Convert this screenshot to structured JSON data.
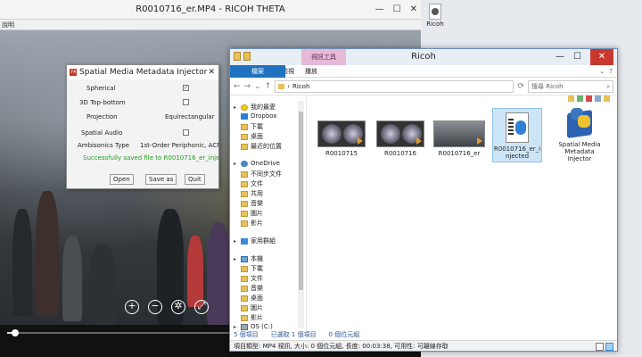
{
  "desktop": {
    "icon_label": "Ricoh"
  },
  "player": {
    "title": "R0010716_er.MP4 - RICOH THETA",
    "menu": "說明",
    "seek_progress": 0.02
  },
  "injector": {
    "title": "Spatial Media Metadata Injector",
    "app_mark": "74",
    "spherical_label": "Spherical",
    "spherical_checked": "✓",
    "top_bottom_label": "3D Top-bottom",
    "projection_label": "Projection",
    "projection_value": "Equirectangular",
    "spatial_audio_label": "Spatial Audio",
    "ambisonics_label": "Ambisonics Type",
    "ambisonics_value": "1st-Order Periphonic, ACN, SN3D",
    "status": "Successfully saved file to R0010716_er_injected.MP4",
    "open_label": "Open",
    "save_as_label": "Save as",
    "quit_label": "Quit",
    "status_color": "#1aa31a"
  },
  "explorer": {
    "title": "Ricoh",
    "context_tab": "視訊工具",
    "ribbon_tabs": [
      "檔案",
      "常用",
      "共用",
      "檢視",
      "播放"
    ],
    "path": "Ricoh",
    "search_placeholder": "搜尋 Ricoh",
    "nav": [
      {
        "label": "我的最愛"
      },
      {
        "label": "Dropbox"
      },
      {
        "label": "下載"
      },
      {
        "label": "桌面"
      },
      {
        "label": "最近的位置"
      },
      {
        "label": "OneDrive"
      },
      {
        "label": "不同步文件"
      },
      {
        "label": "文件"
      },
      {
        "label": "共用"
      },
      {
        "label": "音樂"
      },
      {
        "label": "圖片"
      },
      {
        "label": "影片"
      },
      {
        "label": "家用群組"
      },
      {
        "label": "本機"
      },
      {
        "label": "下載"
      },
      {
        "label": "文件"
      },
      {
        "label": "音樂"
      },
      {
        "label": "桌面"
      },
      {
        "label": "圖片"
      },
      {
        "label": "影片"
      },
      {
        "label": "OS (C:)"
      }
    ],
    "files": [
      {
        "name": "R0010715"
      },
      {
        "name": "R0010716"
      },
      {
        "name": "R0010716_er"
      },
      {
        "name": "R0010716_er_injected"
      },
      {
        "name": "Spatial Media Metadata Injector"
      }
    ],
    "status": {
      "items": "5 個項目",
      "selected": "已選取 1 個項目",
      "size": "0 個位元組"
    },
    "detail": "項目類型: MP4 視訊, 大小: 0 個位元組, 長度: 00:03:38, 可用性: 可離線存取",
    "accent": "#2072c0"
  }
}
